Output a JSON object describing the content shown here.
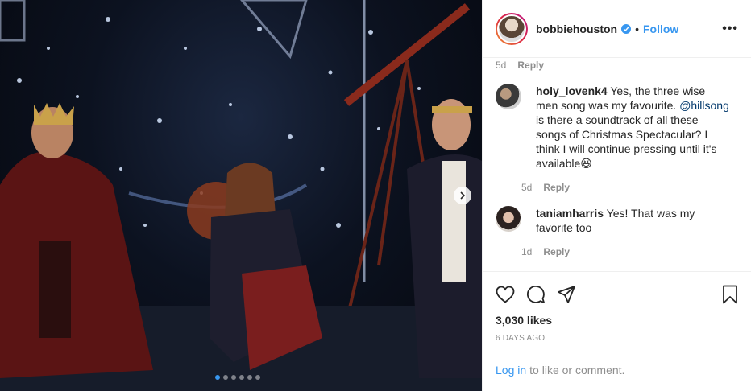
{
  "post": {
    "owner": "bobbiehouston",
    "separator": "•",
    "follow_label": "Follow",
    "more_label": "•••",
    "images_count": 6,
    "active_image": 1
  },
  "comments": {
    "first_meta": {
      "time": "5d",
      "reply": "Reply"
    },
    "items": [
      {
        "user": "holy_lovenk4",
        "text_before": " Yes, the three wise men song was my favourite. ",
        "mention": "@hillsong",
        "text_after": " is there a soundtrack of all these songs of Christmas Spectacular? I think I will continue pressing until it's available😆",
        "time": "5d",
        "reply": "Reply"
      },
      {
        "user": "taniamharris",
        "text_before": " Yes! That was my favorite too",
        "mention": "",
        "text_after": "",
        "time": "1d",
        "reply": "Reply"
      }
    ]
  },
  "actions": {
    "icons": [
      "heart-icon",
      "comment-icon",
      "share-icon",
      "bookmark-icon"
    ]
  },
  "likes": "3,030 likes",
  "posted_ago": "6 DAYS AGO",
  "login": {
    "link": "Log in",
    "text": "to like or comment."
  },
  "colors": {
    "accent": "#3897f0",
    "muted": "#8e8e8e",
    "text": "#262626"
  }
}
